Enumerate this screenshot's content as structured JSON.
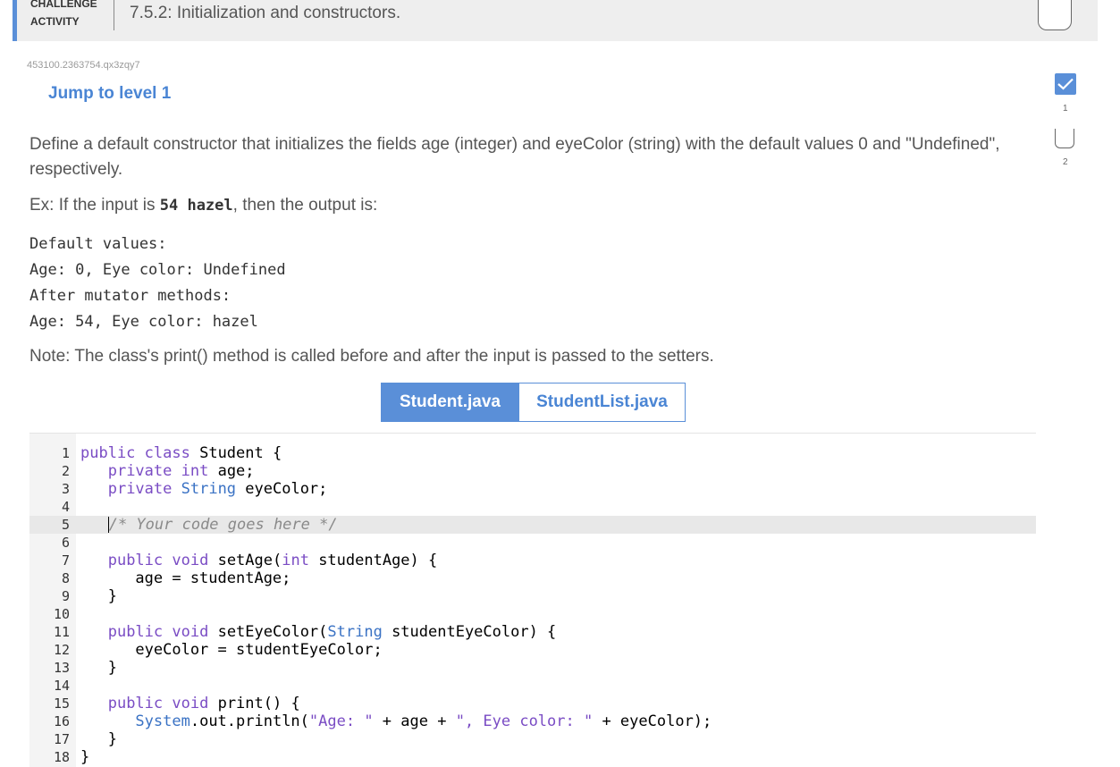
{
  "header": {
    "activity_label_line1": "CHALLENGE",
    "activity_label_line2": "ACTIVITY",
    "title": "7.5.2: Initialization and constructors."
  },
  "challenge_id": "453100.2363754.qx3zqy7",
  "jump_link": "Jump to level 1",
  "description": {
    "paragraph1": "Define a default constructor that initializes the fields age (integer) and eyeColor (string) with the default values 0 and \"Undefined\", respectively.",
    "example_prefix": "Ex: If the input is ",
    "example_input": "54 hazel",
    "example_suffix": ", then the output is:",
    "output_lines": [
      "Default values:",
      "Age: 0, Eye color: Undefined",
      "After mutator methods:",
      "Age: 54, Eye color: hazel"
    ],
    "note": "Note: The class's print() method is called before and after the input is passed to the setters."
  },
  "tabs": [
    {
      "label": "Student.java",
      "active": true
    },
    {
      "label": "StudentList.java",
      "active": false
    }
  ],
  "code_lines": [
    "public class Student {",
    "   private int age;",
    "   private String eyeColor;",
    "",
    "   /* Your code goes here */",
    "",
    "   public void setAge(int studentAge) {",
    "      age = studentAge;",
    "   }",
    "",
    "   public void setEyeColor(String studentEyeColor) {",
    "      eyeColor = studentEyeColor;",
    "   }",
    "",
    "   public void print() {",
    "      System.out.println(\"Age: \" + age + \", Eye color: \" + eyeColor);",
    "   }",
    "}"
  ],
  "line_numbers": [
    "1",
    "2",
    "3",
    "4",
    "5",
    "6",
    "7",
    "8",
    "9",
    "10",
    "11",
    "12",
    "13",
    "14",
    "15",
    "16",
    "17",
    "18"
  ],
  "levels": [
    {
      "number": "1",
      "completed": true
    },
    {
      "number": "2",
      "completed": false
    }
  ],
  "colors": {
    "accent": "#5a8fd8",
    "link": "#4a85d4",
    "keyword": "#7a4cc4",
    "type": "#3a72c4",
    "comment": "#8a8a8a"
  }
}
